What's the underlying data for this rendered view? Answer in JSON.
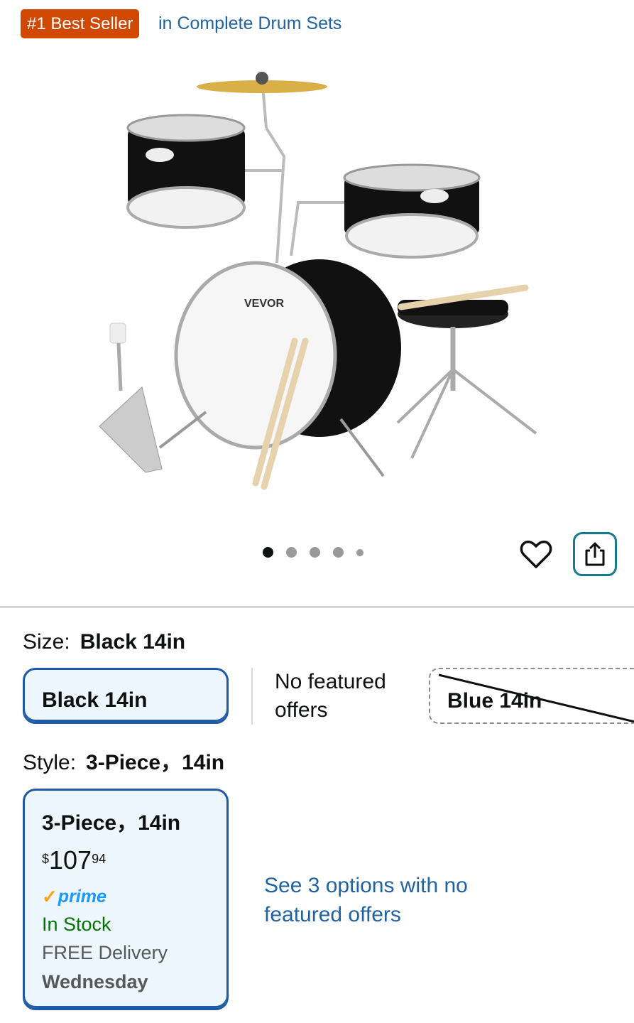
{
  "badge": {
    "label": "#1 Best Seller",
    "category": "in Complete Drum Sets"
  },
  "gallery": {
    "total_images": 5,
    "active_index": 0,
    "image_alt": "drum-set-product-image"
  },
  "actions": {
    "wishlist_icon": "heart-icon",
    "share_icon": "share-icon"
  },
  "size": {
    "label": "Size:",
    "value": "Black 14in",
    "options": [
      {
        "label": "Black 14in",
        "selected": true
      },
      {
        "label": "No featured offers"
      },
      {
        "label": "Blue 14in",
        "unavailable": true
      }
    ]
  },
  "style": {
    "label": "Style:",
    "value": "3-Piece，14in",
    "option": {
      "title": "3-Piece，14in",
      "price_currency": "$",
      "price_whole": "107",
      "price_fraction": "94",
      "prime_check": "✓",
      "prime_label": "prime",
      "stock": "In Stock",
      "delivery": "FREE Delivery",
      "delivery_day": "Wednesday"
    },
    "see_more": "See 3 options with no featured offers"
  },
  "colors": {
    "badge_bg": "#d14900",
    "link": "#2162a1",
    "selected_border": "#1f5aa6",
    "in_stock": "#007600",
    "share_border": "#157a8c"
  }
}
